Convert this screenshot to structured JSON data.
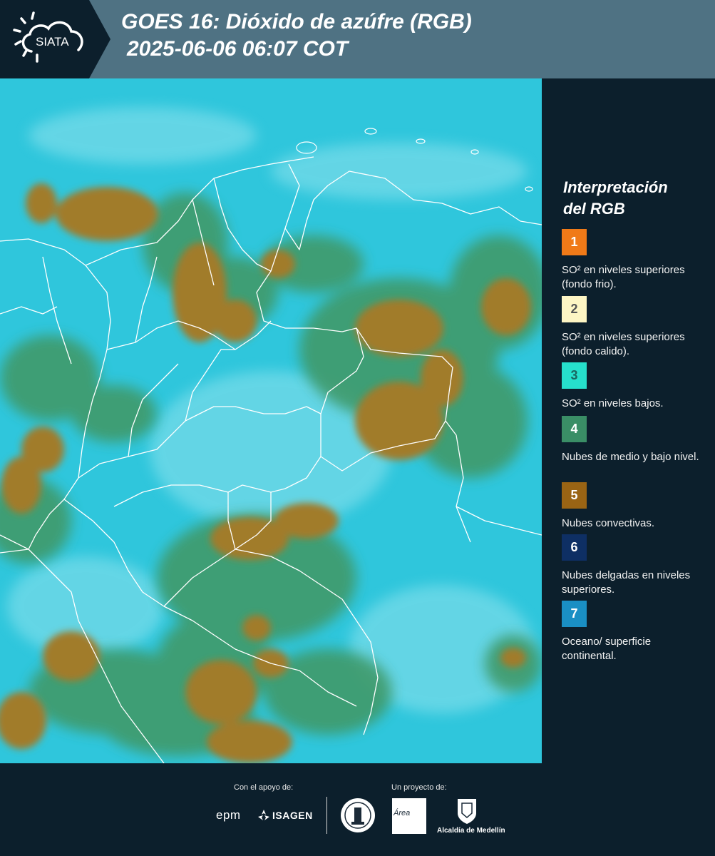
{
  "header": {
    "logo_text": "SIATA",
    "title_line1": "GOES 16: Dióxido de azúfre (RGB)",
    "title_line2": "2025-06-06 06:07 COT",
    "bg_color": "#4f7283"
  },
  "legend": {
    "title_line1": "Interpretación",
    "title_line2": "del RGB",
    "items": [
      {
        "number": "1",
        "color": "#f07a18",
        "text_color": "#ffffff",
        "description": "SO² en niveles superiores (fondo frio)."
      },
      {
        "number": "2",
        "color": "#fdf5c4",
        "text_color": "#555555",
        "description": "SO² en niveles superiores (fondo calido)."
      },
      {
        "number": "3",
        "color": "#26e0cc",
        "text_color": "#1a6660",
        "description": "SO² en niveles bajos."
      },
      {
        "number": "4",
        "color": "#3a8e66",
        "text_color": "#ffffff",
        "description": "Nubes de medio y bajo nivel."
      },
      {
        "number": "5",
        "color": "#9a6414",
        "text_color": "#ffffff",
        "description": "Nubes convectivas."
      },
      {
        "number": "6",
        "color": "#0e2f64",
        "text_color": "#ffffff",
        "description": "Nubes delgadas en niveles superiores."
      },
      {
        "number": "7",
        "color": "#1a8fc4",
        "text_color": "#ffffff",
        "description": "Oceano/ superficie continental."
      }
    ]
  },
  "footer": {
    "support_label": "Con el apoyo de:",
    "project_label": "Un proyecto de:",
    "sponsor_epm": "epm",
    "sponsor_isagen": "ISAGEN",
    "partner_metro": "Área",
    "partner_alcaldia": "Alcaldía de Medellín"
  },
  "map": {
    "ocean_color": "#2fc6dc",
    "cloud_convective_color": "#a17c2c",
    "cloud_low_color": "#3f9a6a",
    "border_color": "#ffffff"
  }
}
